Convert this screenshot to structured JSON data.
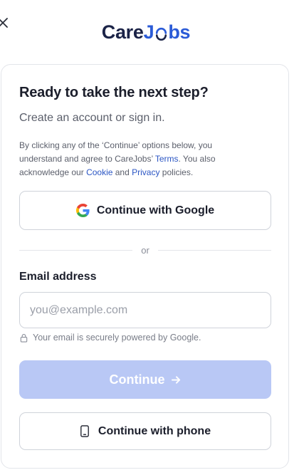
{
  "brand": {
    "care": "Care",
    "j": "J",
    "bs": "bs"
  },
  "header": {
    "close_icon": "close-icon"
  },
  "card": {
    "title": "Ready to take the next step?",
    "subtitle": "Create an account or sign in.",
    "legal": {
      "part1": "By clicking any of the ‘Continue’ options below, you understand and agree to CareJobs’ ",
      "terms": "Terms",
      "part2": ". You also acknowledge our ",
      "cookie": "Cookie",
      "part3": " and ",
      "privacy": "Privacy",
      "part4": " policies."
    },
    "google_button": "Continue with Google",
    "divider": "or",
    "email": {
      "label": "Email address",
      "placeholder": "you@example.com",
      "value": "",
      "note": "Your email is securely powered by Google."
    },
    "continue_button": "Continue",
    "phone_button": "Continue with phone"
  },
  "colors": {
    "brand_dark": "#1b2347",
    "brand_blue": "#2b5bd7",
    "link": "#2b56c4",
    "continue_disabled_bg": "#b9c8f5"
  },
  "icons": [
    "close-icon",
    "google-icon",
    "lock-icon",
    "arrow-right-icon",
    "phone-icon"
  ]
}
